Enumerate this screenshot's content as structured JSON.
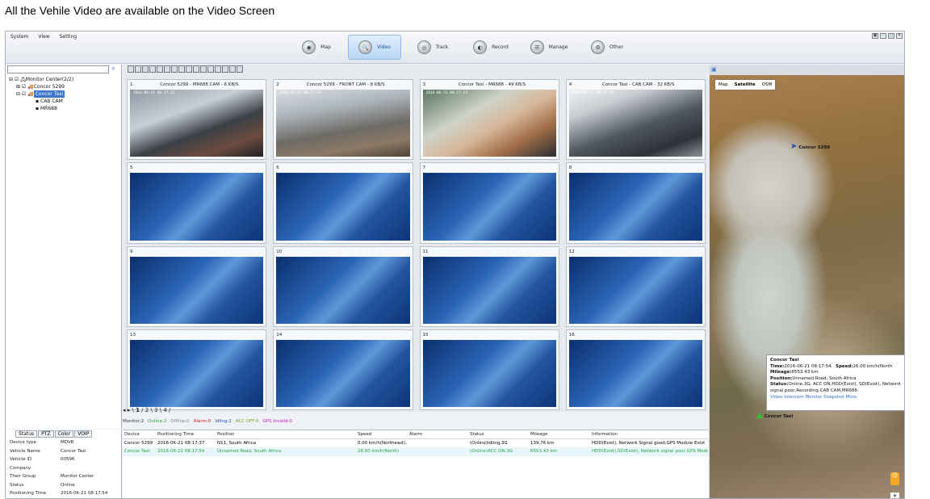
{
  "caption": "All the Vehile Video are available on the Video Screen",
  "menu": [
    "System",
    "View",
    "Setting"
  ],
  "nav": [
    {
      "label": "Map",
      "icon": "map-icon"
    },
    {
      "label": "Video",
      "icon": "video-icon",
      "active": true
    },
    {
      "label": "Track",
      "icon": "track-icon"
    },
    {
      "label": "Record",
      "icon": "record-icon"
    },
    {
      "label": "Manage",
      "icon": "manage-icon"
    },
    {
      "label": "Other",
      "icon": "other-icon"
    }
  ],
  "tree": {
    "root": "Monitor Center(2/2)",
    "vehicle1": "Concor 5299",
    "vehicle2": "Concor Taxi",
    "cam1": "CAB CAM",
    "cam2": "MR688"
  },
  "cells": [
    {
      "n": "1",
      "title": "Concor 5299 - MR688 CAM - 6 KB/S",
      "live": "live1",
      "ts": "2016-06-21 08:17:22"
    },
    {
      "n": "2",
      "title": "Concor 5299 - FRONT CAM - 8 KB/S",
      "live": "live2",
      "ts": "2016-06-21 08:17:22"
    },
    {
      "n": "3",
      "title": "Concor Taxi - MR688 - 49 KB/S",
      "live": "live3",
      "ts": "2016-06-21 08:17:53"
    },
    {
      "n": "4",
      "title": "Concor Taxi - CAB CAM - 32 KB/S",
      "live": "live4",
      "ts": "2016-06-21 08:17:53"
    },
    {
      "n": "5"
    },
    {
      "n": "6"
    },
    {
      "n": "7"
    },
    {
      "n": "8"
    },
    {
      "n": "9"
    },
    {
      "n": "10"
    },
    {
      "n": "11"
    },
    {
      "n": "12"
    },
    {
      "n": "13"
    },
    {
      "n": "14"
    },
    {
      "n": "15"
    },
    {
      "n": "16"
    }
  ],
  "pager": [
    "1",
    "2",
    "3",
    "4"
  ],
  "summary": {
    "monitor": "Monitor:2",
    "online": "Online:2",
    "offline": "Offline:0",
    "alarm": "Alarm:0",
    "idling": "Idling:1",
    "acc": "ACC OFF:0",
    "gps": "GPS Invalid:0"
  },
  "status_tabs": [
    "Status",
    "PTZ",
    "Color",
    "VOIP"
  ],
  "props": [
    {
      "k": "Device type",
      "v": "MDVR"
    },
    {
      "k": "Vehicle Name",
      "v": "Concor Taxi"
    },
    {
      "k": "Vehicle ID",
      "v": "00596"
    },
    {
      "k": "Company",
      "v": ""
    },
    {
      "k": "Their Group",
      "v": "Monitor Center"
    },
    {
      "k": "Status",
      "v": "Online"
    },
    {
      "k": "Positioning Time",
      "v": "2016-06-21 08:17:54"
    }
  ],
  "table": {
    "headers": [
      "Device",
      "Positioning Time",
      "Position",
      "Speed",
      "Alarm",
      "Status",
      "Mileage",
      "Information"
    ],
    "rows": [
      [
        "Concor 5299",
        "2016-06-21 08:17:37",
        "N11, South Africa",
        "0.00 km/h(Northeast),",
        "",
        "(Online)Idling,3G",
        "139.76 km",
        "HDD(Exist), Network Signal good,GPS Module Exist"
      ],
      [
        "Concor Taxi",
        "2016-06-21 08:17:54",
        "Unnamed Road, South Africa",
        "26.00 km/h(North)",
        "",
        "(Online)ACC ON,3G",
        "6553.43 km",
        "HDD(Exist),SD(Exist), Network signal poor,GPS Module"
      ]
    ]
  },
  "map": {
    "types": [
      "Map",
      "Satellite",
      "OSM"
    ],
    "marker1": "Concor 5299",
    "marker2": "Concor Taxi",
    "popup": {
      "title": "Concor Taxi",
      "time_label": "Time:",
      "time": "2016-06-21 08:17:54",
      "speed_label": "Speed:",
      "speed": "26.00 km/h(North",
      "mileage_label": "Mileage:",
      "mileage": "6553.43 km",
      "position_label": "Position:",
      "position": "Unnamed Road, South Africa",
      "status_label": "Status:",
      "status": "Online,3G, ACC ON,HDD(Exist), SD(Exist), Network signal poor,Recording:CAB CAM,MR688",
      "links": "Video  Intercom  Monitor  Snapshot  More"
    }
  }
}
